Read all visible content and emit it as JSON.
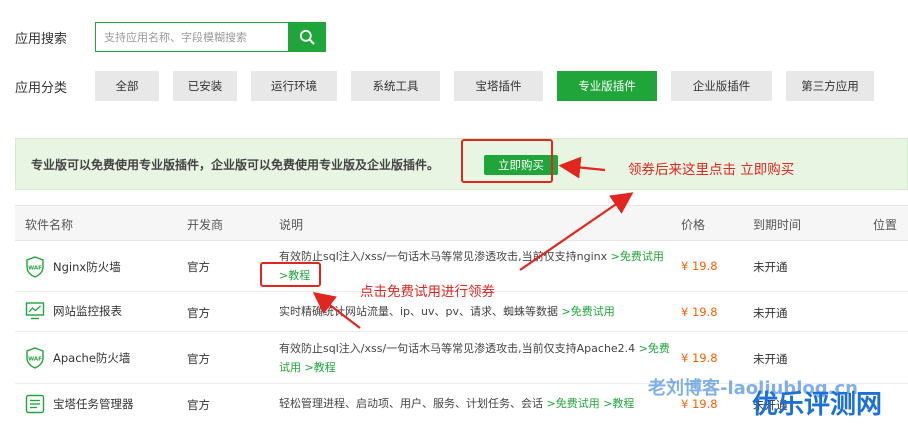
{
  "search": {
    "label": "应用搜索",
    "placeholder": "支持应用名称、字段模糊搜索",
    "icon": "search-icon"
  },
  "categories": {
    "label": "应用分类",
    "items": [
      "全部",
      "已安装",
      "运行环境",
      "系统工具",
      "宝塔插件",
      "专业版插件",
      "企业版插件",
      "第三方应用"
    ],
    "active": "专业版插件"
  },
  "notice": {
    "text": "专业版可以免费使用专业版插件，企业版可以免费使用专业版及企业版插件。",
    "buy_label": "立即购买"
  },
  "annotations": {
    "buy_hint": "领券后来这里点击 立即购买",
    "trial_hint": "点击免费试用进行领券"
  },
  "table": {
    "headers": [
      "软件名称",
      "开发商",
      "说明",
      "价格",
      "到期时间",
      "位置"
    ],
    "rows": [
      {
        "icon": "waf-shield-icon",
        "name": "Nginx防火墙",
        "developer": "官方",
        "desc": "有效防止sql注入/xss/一句话木马等常见渗透攻击,当前仅支持nginx",
        "trial": ">免费试用",
        "tutorial": ">教程",
        "price": "¥ 19.8",
        "expiry": "未开通"
      },
      {
        "icon": "monitor-chart-icon",
        "name": "网站监控报表",
        "developer": "官方",
        "desc": "实时精确统计网站流量、ip、uv、pv、请求、蜘蛛等数据",
        "trial": ">免费试用",
        "price": "¥ 19.8",
        "expiry": "未开通"
      },
      {
        "icon": "waf-shield-icon",
        "name": "Apache防火墙",
        "developer": "官方",
        "desc": "有效防止sql注入/xss/一句话木马等常见渗透攻击,当前仅支持Apache2.4",
        "trial": ">免费试用",
        "tutorial": ">教程",
        "price": "¥ 19.8",
        "expiry": "未开通"
      },
      {
        "icon": "task-list-icon",
        "name": "宝塔任务管理器",
        "developer": "官方",
        "desc": "轻松管理进程、启动项、用户、服务、计划任务、会话",
        "trial": ">免费试用",
        "tutorial": ">教程",
        "price": "¥ 19.8",
        "expiry": "未开通"
      }
    ]
  },
  "watermarks": {
    "blog": "老刘博客-laoliublog.cn",
    "site": "优乐评测网"
  },
  "colors": {
    "accent": "#20a53a",
    "annotation": "#e0261f",
    "price": "#ff5c00",
    "watermark": "#1a6fd8"
  }
}
